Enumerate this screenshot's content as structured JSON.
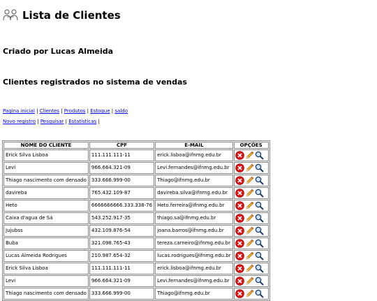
{
  "header": {
    "title": "Lista de Clientes",
    "logo_icon": "people-icon"
  },
  "author": "Criado por Lucas Almeida",
  "subtitle": "Clientes registrados no sistema de vendas",
  "nav_row1": [
    {
      "label": "Pagina inicial"
    },
    {
      "label": "Clientes"
    },
    {
      "label": "Produtos"
    },
    {
      "label": "Estoque"
    },
    {
      "label": "saldo"
    }
  ],
  "nav_row2": [
    {
      "label": "Novo registro"
    },
    {
      "label": "Pesquisar"
    },
    {
      "label": "Estatísticas"
    }
  ],
  "table": {
    "columns": [
      "NOME DO CLIENTE",
      "CPF",
      "E-MAIL",
      "OPÇÕES"
    ],
    "rows": [
      [
        "Erick Silva Lisboa",
        "111.111.111-11",
        "erick.lisboa@ifnmg.edu.br"
      ],
      [
        "Levi",
        "966.664.321-09",
        "Levi.fernandes@ifnmg.edu.br"
      ],
      [
        "Thiago nascimento com densado",
        "333.666.999-00",
        "Thiago@ifnmg.edu.br"
      ],
      [
        "davireba",
        "765.432.109-87",
        "davireba.silva@ifnmg.edu.br"
      ],
      [
        "Heto",
        "6666666666.333.338-76",
        "Heto.ferreira@ifnmg.edu.br"
      ],
      [
        "Caixa d'agua de Sá",
        "543.252.917-35",
        "thiago.sa@ifnmg.edu.br"
      ],
      [
        "Jujubss",
        "432.109.876-54",
        "joana.barros@ifnmg.edu.br"
      ],
      [
        "Buba",
        "321.098.765-43",
        "tereza.carneiro@ifnmg.edu.br"
      ],
      [
        "Lucas Almeida Rodrigues",
        "210.987.654-32",
        "lucas.rodrigues@ifnmg.edu.br"
      ],
      [
        "Erick Silva Lisboa",
        "111.111.111-11",
        "erick.lisboa@ifnmg.edu.br"
      ],
      [
        "Levi",
        "966.664.321-09",
        "Levi.fernandes@ifnmg.edu.br"
      ],
      [
        "Thiago nascimento com densado",
        "333.666.999-00",
        "Thiago@ifnmg.edu.br"
      ]
    ],
    "option_icons": [
      "delete-icon",
      "edit-icon",
      "search-icon"
    ]
  },
  "colors": {
    "link": "#0000ee",
    "delete": "#dd1111",
    "edit": "#e8a020"
  }
}
